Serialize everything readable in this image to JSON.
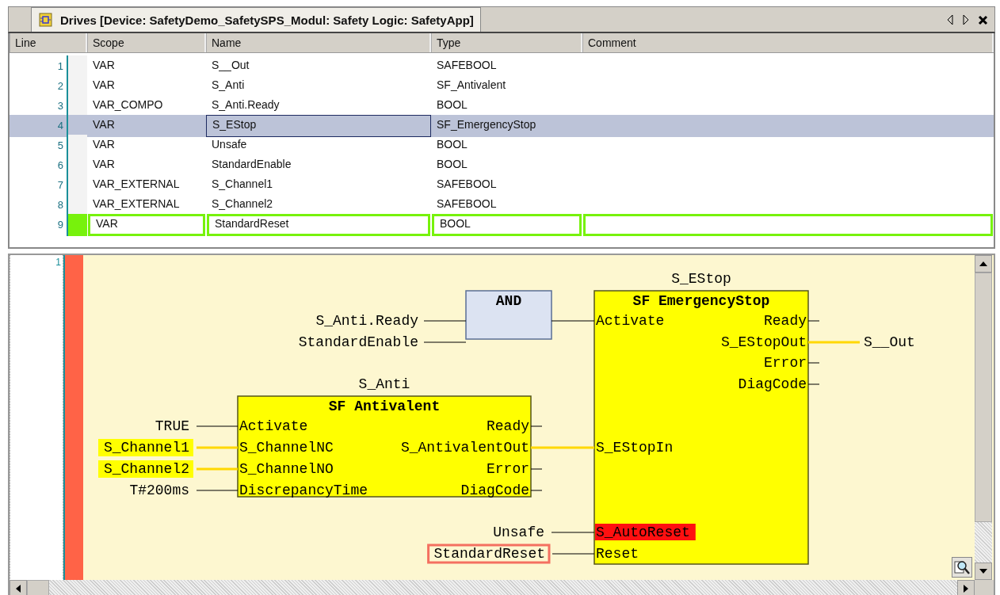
{
  "tab": {
    "title": "Drives [Device: SafetyDemo_SafetySPS_Modul: Safety Logic: SafetyApp]"
  },
  "table": {
    "columns": [
      "Line",
      "Scope",
      "Name",
      "Type",
      "Comment"
    ],
    "rows": [
      {
        "line": "1",
        "scope": "VAR",
        "name": "S__Out",
        "type": "SAFEBOOL",
        "selected": false,
        "modified": false
      },
      {
        "line": "2",
        "scope": "VAR",
        "name": "S_Anti",
        "type": "SF_Antivalent",
        "selected": false,
        "modified": false
      },
      {
        "line": "3",
        "scope": "VAR_COMPO",
        "name": "S_Anti.Ready",
        "type": "BOOL",
        "selected": false,
        "modified": false
      },
      {
        "line": "4",
        "scope": "VAR",
        "name": "S_EStop",
        "type": "SF_EmergencyStop",
        "selected": true,
        "modified": false
      },
      {
        "line": "5",
        "scope": "VAR",
        "name": "Unsafe",
        "type": "BOOL",
        "selected": false,
        "modified": false
      },
      {
        "line": "6",
        "scope": "VAR",
        "name": "StandardEnable",
        "type": "BOOL",
        "selected": false,
        "modified": false
      },
      {
        "line": "7",
        "scope": "VAR_EXTERNAL",
        "name": "S_Channel1",
        "type": "SAFEBOOL",
        "selected": false,
        "modified": false
      },
      {
        "line": "8",
        "scope": "VAR_EXTERNAL",
        "name": "S_Channel2",
        "type": "SAFEBOOL",
        "selected": false,
        "modified": false
      },
      {
        "line": "9",
        "scope": "VAR",
        "name": "StandardReset",
        "type": "BOOL",
        "selected": false,
        "modified": true
      }
    ]
  },
  "diagram": {
    "network": "1",
    "network_error": true,
    "and_block": {
      "title": "AND",
      "inputs": [
        {
          "source": "S_Anti.Ready"
        },
        {
          "source": "StandardEnable"
        }
      ]
    },
    "function_blocks": [
      {
        "instance": "S_Anti",
        "type": "SF Antivalent",
        "inputs": [
          {
            "pin": "Activate",
            "source": "TRUE",
            "safe": false,
            "flagged": false,
            "error": false
          },
          {
            "pin": "S_ChannelNC",
            "source": "S_Channel1",
            "safe": true,
            "flagged": false,
            "error": false
          },
          {
            "pin": "S_ChannelNO",
            "source": "S_Channel2",
            "safe": true,
            "flagged": false,
            "error": false
          },
          {
            "pin": "DiscrepancyTime",
            "source": "T#200ms",
            "safe": false,
            "flagged": false,
            "error": false
          }
        ],
        "outputs": [
          {
            "pin": "Ready",
            "safe": false
          },
          {
            "pin": "S_AntivalentOut",
            "safe": true
          },
          {
            "pin": "Error",
            "safe": false
          },
          {
            "pin": "DiagCode",
            "safe": false
          }
        ]
      },
      {
        "instance": "S_EStop",
        "type": "SF EmergencyStop",
        "inputs": [
          {
            "pin": "Activate",
            "safe": false,
            "error": false
          },
          {
            "pin": "S_EStopIn",
            "safe": true,
            "error": false
          },
          {
            "pin": "S_AutoReset",
            "source": "Unsafe",
            "safe": false,
            "flagged": false,
            "error": true
          },
          {
            "pin": "Reset",
            "source": "StandardReset",
            "safe": false,
            "flagged": true,
            "error": false
          }
        ],
        "outputs": [
          {
            "pin": "Ready",
            "safe": false
          },
          {
            "pin": "S_EStopOut",
            "target": "S__Out",
            "safe": true
          },
          {
            "pin": "Error",
            "safe": false
          },
          {
            "pin": "DiagCode",
            "safe": false
          }
        ]
      }
    ]
  }
}
